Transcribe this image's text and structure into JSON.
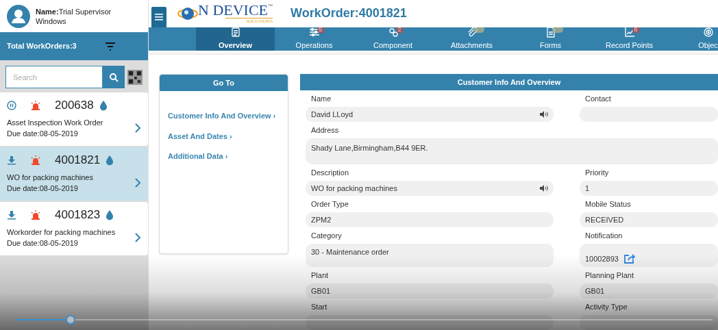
{
  "user": {
    "label": "Name:",
    "name": "Trial Supervisor",
    "device": "Windows"
  },
  "logo": {
    "word": "N DEVICE",
    "tm": "™",
    "sub": "SOLUTIONS"
  },
  "title": "WorkOrder:4001821",
  "sidebar": {
    "total": "Total WorkOrders:3",
    "search": {
      "placeholder": "Search"
    },
    "work_orders": [
      {
        "kind": "pause",
        "number": "200638",
        "title": "Asset Inspection Work Order",
        "due": "Due date:08-05-2019",
        "selected": false
      },
      {
        "kind": "download",
        "number": "4001821",
        "title": "WO for packing machines",
        "due": "Due date:08-05-2019",
        "selected": true
      },
      {
        "kind": "download",
        "number": "4001823",
        "title": "Workorder for packing machines",
        "due": "Due date:08-05-2019",
        "selected": false
      }
    ]
  },
  "tabs": [
    {
      "kind": "document",
      "label": "Overview",
      "selected": true
    },
    {
      "kind": "sliders",
      "label": "Operations",
      "badge": {
        "kind": "count",
        "text": "5"
      },
      "selected": false
    },
    {
      "kind": "gears",
      "label": "Component",
      "badge": {
        "kind": "count",
        "text": "2"
      },
      "selected": false
    },
    {
      "kind": "paperclip",
      "label": "Attachments",
      "badge": {
        "kind": "empty"
      },
      "selected": false
    },
    {
      "kind": "form",
      "label": "Forms",
      "badge": {
        "kind": "empty"
      },
      "selected": false
    },
    {
      "kind": "chart",
      "label": "Record Points",
      "badge": {
        "kind": "count",
        "text": "6"
      },
      "selected": false
    },
    {
      "kind": "target",
      "label": "Objec",
      "selected": false
    }
  ],
  "goto": {
    "title": "Go To",
    "links": [
      "Customer Info And Overview ›",
      "Asset And Dates ›",
      "Additional Data ›"
    ]
  },
  "panel": {
    "title": "Customer Info And Overview",
    "rows": [
      [
        {
          "label": "Name",
          "value": "David LLoyd",
          "speaker": true
        },
        {
          "label": "Contact"
        }
      ],
      [
        {
          "label": "Address",
          "value": "Shady Lane,Birmingham,B44 9ER.",
          "kind": "wide"
        }
      ],
      [
        {
          "label": "Description",
          "value": "WO for packing machines",
          "speaker": true
        },
        {
          "label": "Priority",
          "value": "1"
        }
      ],
      [
        {
          "label": "Order Type",
          "value": "ZPM2"
        },
        {
          "label": "Mobile Status",
          "value": "RECEIVED"
        }
      ],
      [
        {
          "label": "Category",
          "value": "30 - Maintenance order",
          "kind": "tall"
        },
        {
          "label": "Notification",
          "value": "10002893",
          "kind": "link"
        }
      ],
      [
        {
          "label": "Plant",
          "value": "GB01"
        },
        {
          "label": "Planning Plant",
          "value": "GB01"
        }
      ],
      [
        {
          "label": "Start"
        },
        {
          "label": "Activity Type"
        }
      ]
    ]
  },
  "player": {
    "seek": {
      "level": 0.08
    }
  }
}
